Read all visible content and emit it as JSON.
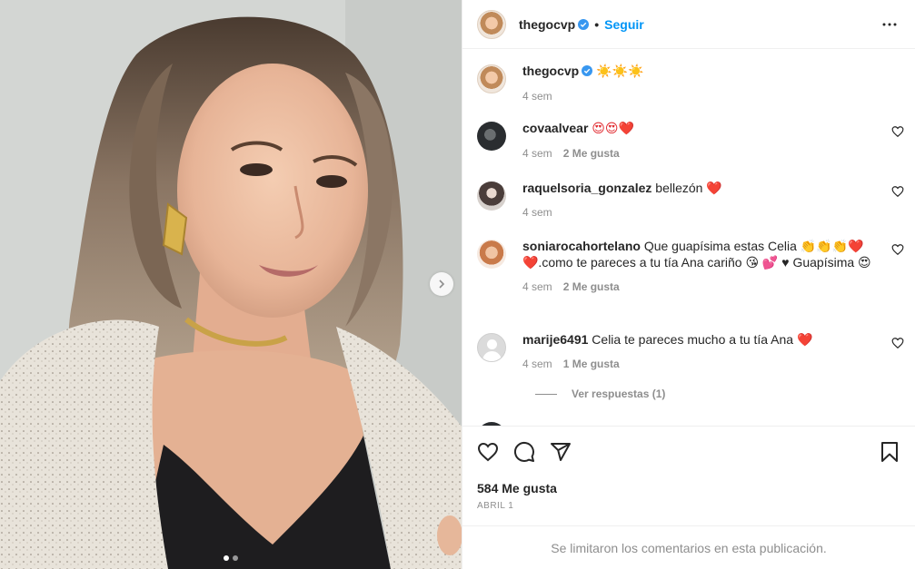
{
  "post": {
    "author": "thegocvp",
    "follow_label": "Seguir",
    "separator": "•",
    "caption": {
      "username": "thegocvp",
      "text": "☀️☀️☀️",
      "time": "4 sem"
    },
    "comments": [
      {
        "username": "covaalvear",
        "text": "😍😍❤️",
        "time": "4 sem",
        "likes": "2 Me gusta"
      },
      {
        "username": "raquelsoria_gonzalez",
        "text": "bellezón ❤️",
        "time": "4 sem",
        "likes": ""
      },
      {
        "username": "soniarocahortelano",
        "text": "Que guapísima estas Celia 👏👏👏❤️❤️.como te pareces a tu tía Ana cariño 😘 💕 ♥ Guapísima 😍",
        "time": "4 sem",
        "likes": "2 Me gusta"
      },
      {
        "username": "marije6491",
        "text": "Celia te pareces mucho a tu tía Ana ❤️",
        "time": "4 sem",
        "likes": "1 Me gusta"
      }
    ],
    "view_replies": "Ver respuestas (1)",
    "likes_total": "584 Me gusta",
    "date": "ABRIL 1",
    "comments_limited": "Se limitaron los comentarios en esta publicación.",
    "carousel": {
      "count": 2,
      "active": 0
    }
  },
  "icons": {
    "more": "more-horizontal-icon",
    "like": "heart-icon",
    "comment": "comment-icon",
    "share": "share-icon",
    "save": "bookmark-icon",
    "next": "chevron-right-icon",
    "verified": "verified-badge-icon"
  },
  "colors": {
    "link": "#0095f6",
    "muted": "#8e8e8e",
    "text": "#262626",
    "verified": "#3897f0"
  }
}
